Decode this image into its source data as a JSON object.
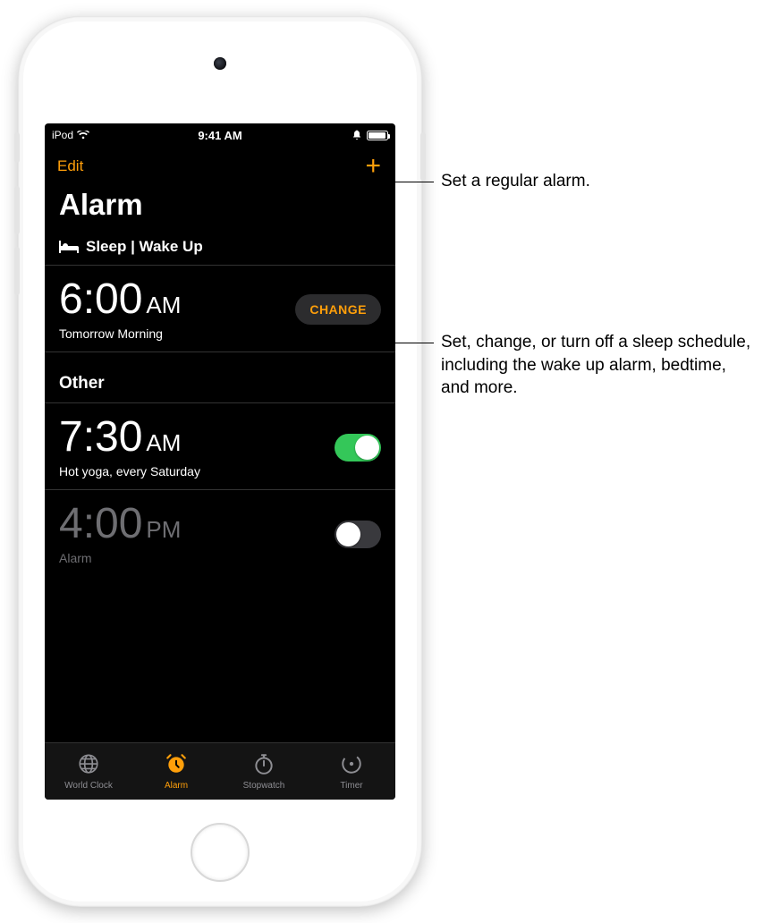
{
  "status": {
    "device": "iPod",
    "time": "9:41 AM"
  },
  "nav": {
    "edit": "Edit",
    "title": "Alarm"
  },
  "sleep": {
    "header": "Sleep | Wake Up",
    "time": "6:00",
    "ampm": "AM",
    "sub": "Tomorrow Morning",
    "change": "CHANGE"
  },
  "other": {
    "header": "Other",
    "alarms": [
      {
        "time": "7:30",
        "ampm": "AM",
        "sub": "Hot yoga, every Saturday",
        "on": true
      },
      {
        "time": "4:00",
        "ampm": "PM",
        "sub": "Alarm",
        "on": false
      }
    ]
  },
  "tabs": {
    "world": "World Clock",
    "alarm": "Alarm",
    "stopwatch": "Stopwatch",
    "timer": "Timer"
  },
  "callouts": {
    "add": "Set a regular alarm.",
    "change": "Set, change, or turn off a sleep schedule, including the wake up alarm, bedtime, and more."
  }
}
